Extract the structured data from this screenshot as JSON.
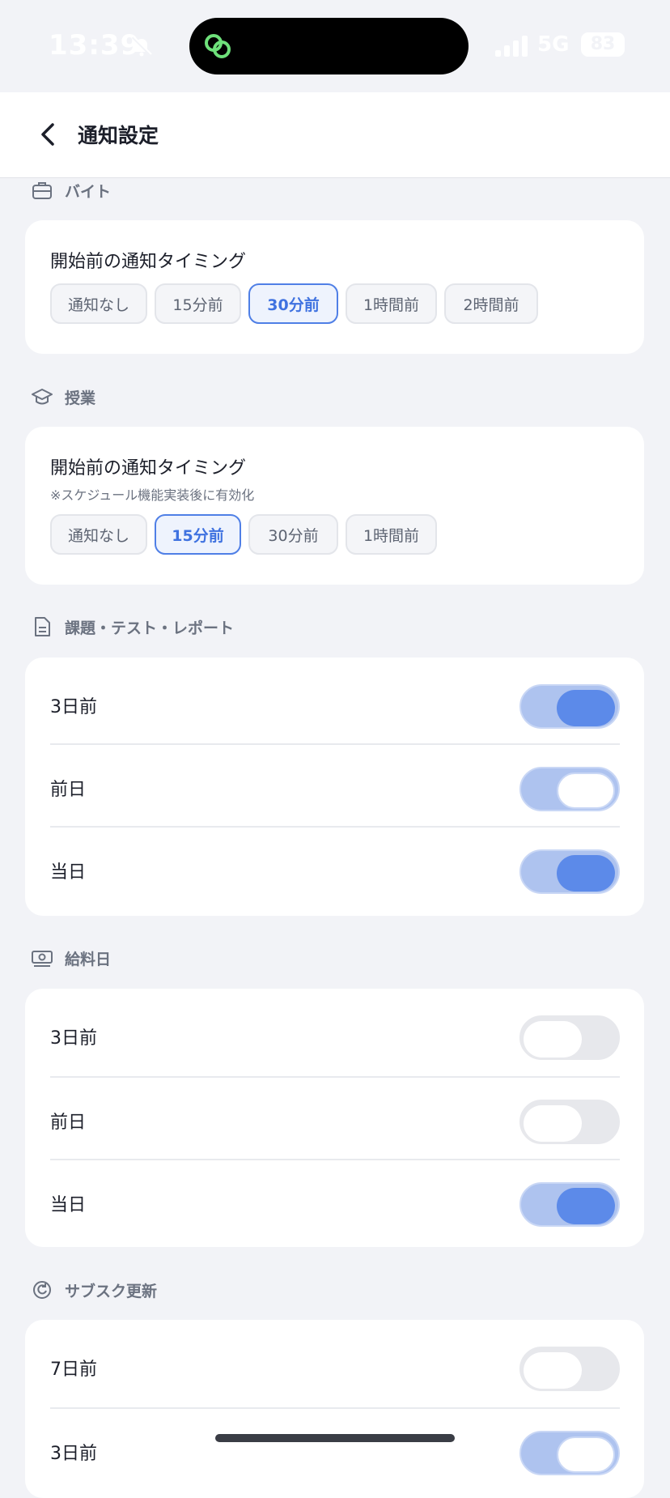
{
  "status_bar": {
    "time": "13:39",
    "network": "5G",
    "battery": "83"
  },
  "header": {
    "title": "通知設定"
  },
  "sections": [
    {
      "label": "バイト",
      "icon": "briefcase-icon",
      "card_title": "開始前の通知タイミング",
      "options": [
        "通知なし",
        "15分前",
        "30分前",
        "1時間前",
        "2時間前"
      ],
      "selected": "30分前"
    },
    {
      "label": "授業",
      "icon": "graduation-cap-icon",
      "card_title": "開始前の通知タイミング",
      "note": "※スケジュール機能実装後に有効化",
      "options": [
        "通知なし",
        "15分前",
        "30分前",
        "1時間前"
      ],
      "selected": "15分前"
    },
    {
      "label": "課題・テスト・レポート",
      "icon": "document-icon",
      "rows": [
        {
          "label": "3日前",
          "state": "on"
        },
        {
          "label": "前日",
          "state": "on"
        },
        {
          "label": "当日",
          "state": "on"
        }
      ]
    },
    {
      "label": "給料日",
      "icon": "money-icon",
      "rows": [
        {
          "label": "3日前",
          "state": "off"
        },
        {
          "label": "前日",
          "state": "off"
        },
        {
          "label": "当日",
          "state": "on"
        }
      ]
    },
    {
      "label": "サブスク更新",
      "icon": "refresh-icon",
      "rows": [
        {
          "label": "7日前",
          "state": "off"
        },
        {
          "label": "3日前",
          "state": "on"
        }
      ]
    }
  ],
  "colors": {
    "accent": "#4f7fe6",
    "toggle_on": "#5c8ae9",
    "toggle_track_on": "#aec3ef",
    "background": "#f2f3f7"
  }
}
